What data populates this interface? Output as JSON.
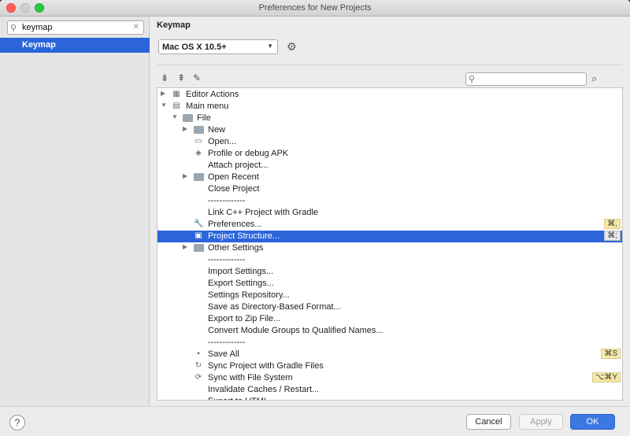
{
  "window": {
    "title": "Preferences for New Projects"
  },
  "sidebar": {
    "search_value": "keymap",
    "items": [
      {
        "label": "Keymap",
        "selected": true
      }
    ]
  },
  "main": {
    "heading": "Keymap",
    "scheme": "Mac OS X 10.5+",
    "toolbar": [
      "expand-all-icon",
      "collapse-all-icon",
      "edit-icon"
    ],
    "tree": [
      {
        "label": "Editor Actions",
        "level": 0,
        "expander": "▶",
        "icon": "editor-actions-icon",
        "shortcut": ""
      },
      {
        "label": "Main menu",
        "level": 0,
        "expander": "▼",
        "icon": "main-menu-icon",
        "shortcut": ""
      },
      {
        "label": "File",
        "level": 1,
        "expander": "▼",
        "icon": "folder-icon",
        "shortcut": ""
      },
      {
        "label": "New",
        "level": 2,
        "expander": "▶",
        "icon": "folder-icon",
        "shortcut": ""
      },
      {
        "label": "Open...",
        "level": 2,
        "expander": "",
        "icon": "open-folder-icon",
        "shortcut": ""
      },
      {
        "label": "Profile or debug APK",
        "level": 2,
        "expander": "",
        "icon": "apk-icon",
        "shortcut": ""
      },
      {
        "label": "Attach project...",
        "level": 2,
        "expander": "",
        "icon": "",
        "shortcut": ""
      },
      {
        "label": "Open Recent",
        "level": 2,
        "expander": "▶",
        "icon": "folder-icon",
        "shortcut": ""
      },
      {
        "label": "Close Project",
        "level": 2,
        "expander": "",
        "icon": "",
        "shortcut": ""
      },
      {
        "label": "-------------",
        "level": 2,
        "expander": "",
        "icon": "",
        "shortcut": ""
      },
      {
        "label": "Link C++ Project with Gradle",
        "level": 2,
        "expander": "",
        "icon": "",
        "shortcut": ""
      },
      {
        "label": "Preferences...",
        "level": 2,
        "expander": "",
        "icon": "wrench-icon",
        "shortcut": "⌘,"
      },
      {
        "label": "Project Structure...",
        "level": 2,
        "expander": "",
        "icon": "project-structure-icon",
        "shortcut": "⌘;",
        "selected": true
      },
      {
        "label": "Other Settings",
        "level": 2,
        "expander": "▶",
        "icon": "folder-icon",
        "shortcut": ""
      },
      {
        "label": "-------------",
        "level": 2,
        "expander": "",
        "icon": "",
        "shortcut": ""
      },
      {
        "label": "Import Settings...",
        "level": 2,
        "expander": "",
        "icon": "",
        "shortcut": ""
      },
      {
        "label": "Export Settings...",
        "level": 2,
        "expander": "",
        "icon": "",
        "shortcut": ""
      },
      {
        "label": "Settings Repository...",
        "level": 2,
        "expander": "",
        "icon": "",
        "shortcut": ""
      },
      {
        "label": "Save as Directory-Based Format...",
        "level": 2,
        "expander": "",
        "icon": "",
        "shortcut": ""
      },
      {
        "label": "Export to Zip File...",
        "level": 2,
        "expander": "",
        "icon": "",
        "shortcut": ""
      },
      {
        "label": "Convert Module Groups to Qualified Names...",
        "level": 2,
        "expander": "",
        "icon": "",
        "shortcut": ""
      },
      {
        "label": "-------------",
        "level": 2,
        "expander": "",
        "icon": "",
        "shortcut": ""
      },
      {
        "label": "Save All",
        "level": 2,
        "expander": "",
        "icon": "save-icon",
        "shortcut": "⌘S"
      },
      {
        "label": "Sync Project with Gradle Files",
        "level": 2,
        "expander": "",
        "icon": "gradle-sync-icon",
        "shortcut": ""
      },
      {
        "label": "Sync with File System",
        "level": 2,
        "expander": "",
        "icon": "refresh-icon",
        "shortcut": "⌥⌘Y"
      },
      {
        "label": "Invalidate Caches / Restart...",
        "level": 2,
        "expander": "",
        "icon": "",
        "shortcut": ""
      },
      {
        "label": "Export to HTML...",
        "level": 2,
        "expander": "",
        "icon": "",
        "shortcut": ""
      }
    ]
  },
  "buttons": {
    "cancel": "Cancel",
    "apply": "Apply",
    "ok": "OK",
    "help": "?"
  },
  "colors": {
    "selection": "#2b65d9",
    "ok_button": "#3b78e0",
    "shortcut_badge": "#f5e9a8"
  }
}
